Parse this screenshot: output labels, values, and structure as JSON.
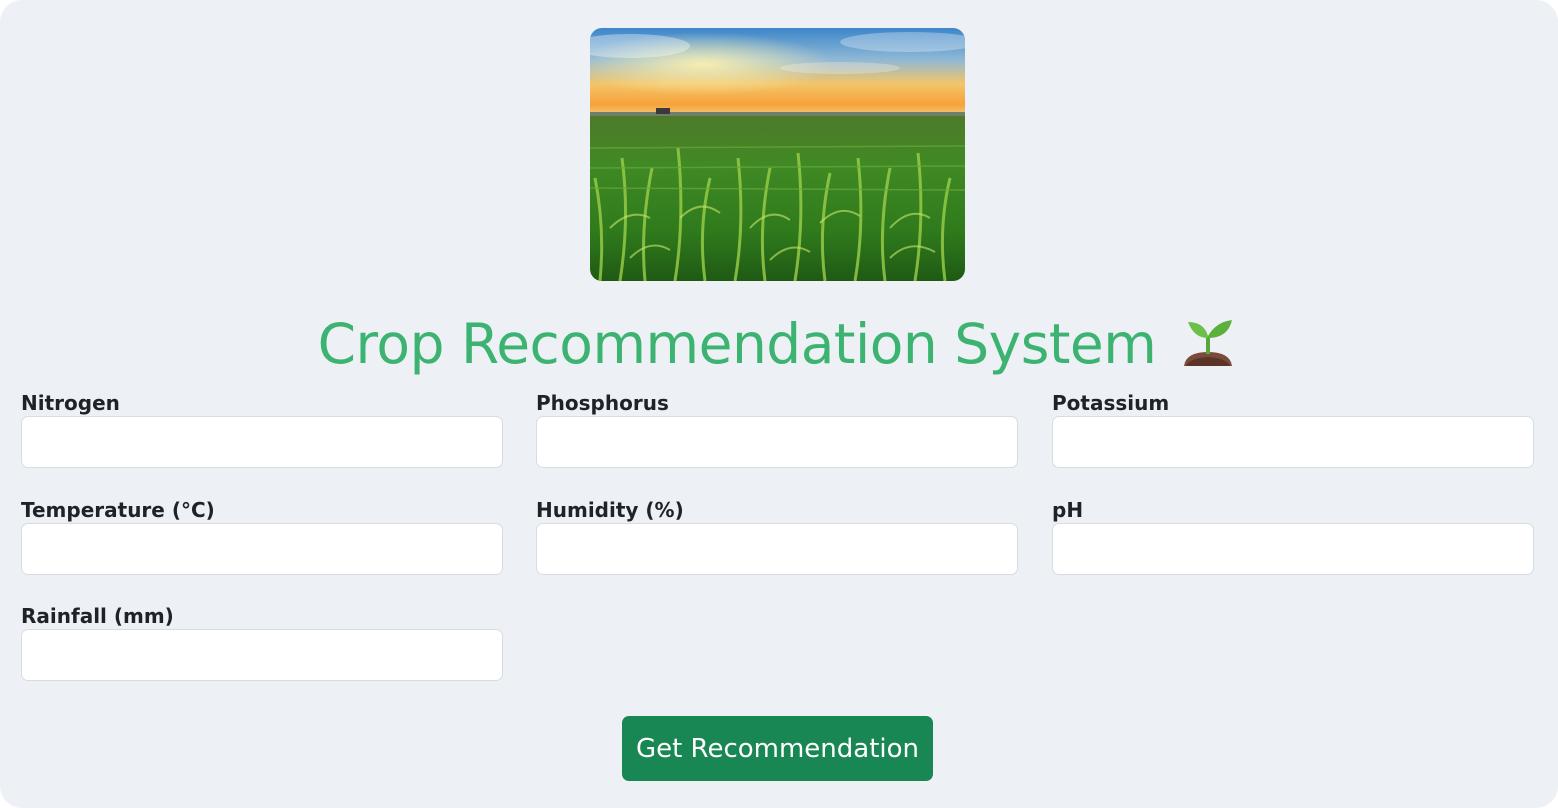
{
  "page": {
    "title": "Crop Recommendation System",
    "title_emoji_icon": "seedling-icon",
    "hero_image": "cornfield-sunset-photo"
  },
  "form": {
    "fields": [
      {
        "label": "Nitrogen",
        "value": "",
        "placeholder": ""
      },
      {
        "label": "Phosphorus",
        "value": "",
        "placeholder": ""
      },
      {
        "label": "Potassium",
        "value": "",
        "placeholder": ""
      },
      {
        "label": "Temperature (°C)",
        "value": "",
        "placeholder": ""
      },
      {
        "label": "Humidity (%)",
        "value": "",
        "placeholder": ""
      },
      {
        "label": "pH",
        "value": "",
        "placeholder": ""
      },
      {
        "label": "Rainfall (mm)",
        "value": "",
        "placeholder": ""
      }
    ],
    "submit_label": "Get Recommendation"
  },
  "colors": {
    "background": "#edf1f5",
    "title": "#3cb371",
    "button": "#198754",
    "button_text": "#ffffff"
  }
}
